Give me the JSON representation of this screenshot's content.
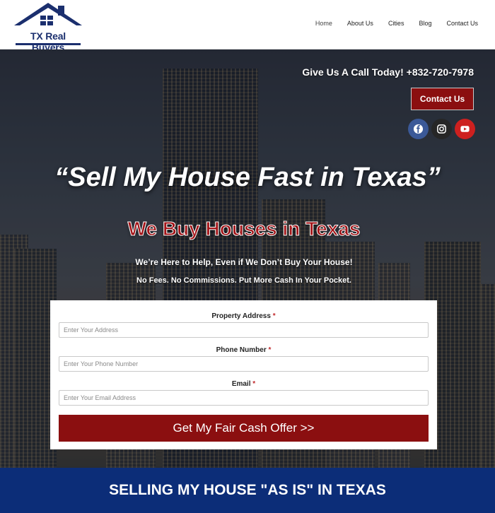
{
  "brand": {
    "name": "TX Real Buyers",
    "color": "#1b2f6e"
  },
  "nav": {
    "items": [
      {
        "label": "Home",
        "active": true
      },
      {
        "label": "About Us",
        "active": false
      },
      {
        "label": "Cities",
        "active": false
      },
      {
        "label": "Blog",
        "active": false
      },
      {
        "label": "Contact Us",
        "active": false
      }
    ]
  },
  "hero": {
    "call_text": "Give Us A Call Today! +832-720-7978",
    "contact_button": "Contact Us",
    "social": [
      {
        "icon": "facebook-icon",
        "color": "#3b5998"
      },
      {
        "icon": "instagram-icon",
        "color": "#262626"
      },
      {
        "icon": "youtube-icon",
        "color": "#cd201f"
      }
    ],
    "headline": "“Sell My House Fast in Texas”",
    "subheadline": "We Buy Houses in Texas",
    "tagline_1": "We’re Here to Help, Even if We Don’t Buy Your House!",
    "tagline_2": "No Fees. No Commissions. Put More Cash In Your Pocket."
  },
  "form": {
    "fields": [
      {
        "label": "Property Address",
        "required_mark": "*",
        "placeholder": "Enter Your Address",
        "value": ""
      },
      {
        "label": "Phone Number",
        "required_mark": "*",
        "placeholder": "Enter Your Phone Number",
        "value": ""
      },
      {
        "label": "Email",
        "required_mark": "*",
        "placeholder": "Enter Your Email Address",
        "value": ""
      }
    ],
    "submit_label": "Get My Fair Cash Offer >>"
  },
  "band": {
    "text": "SELLING MY HOUSE \"AS IS\" IN TEXAS",
    "color": "#0c2d78"
  },
  "colors": {
    "accent": "#8b0f10"
  }
}
